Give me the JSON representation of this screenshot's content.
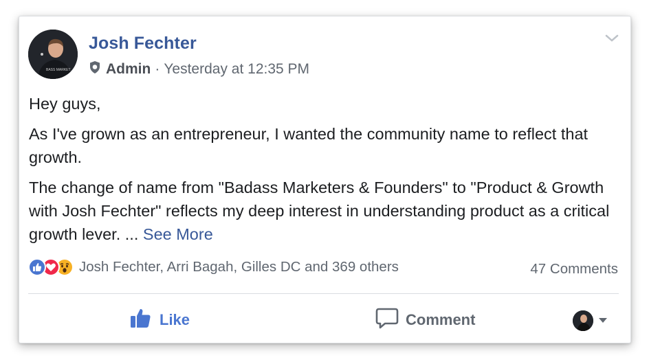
{
  "post": {
    "author": "Josh Fechter",
    "role": "Admin",
    "separator": "·",
    "timestamp": "Yesterday at 12:35 PM",
    "paragraphs": [
      "Hey guys,",
      "As I've grown as an entrepreneur, I wanted the community name to reflect that growth.",
      "The change of name from \"Badass Marketers & Founders\" to \"Product & Growth with Josh Fechter\" reflects my deep interest in understanding product as a critical growth lever. ..."
    ],
    "see_more": "See More"
  },
  "reactions": {
    "types": [
      "like-icon",
      "love-icon",
      "wow-icon"
    ],
    "names": "Josh Fechter, Arri Bagah, Gilles DC and 369 others",
    "comments": "47 Comments"
  },
  "actions": {
    "like": "Like",
    "comment": "Comment"
  },
  "colors": {
    "link": "#385898",
    "like_blue": "#4a76d0",
    "love_red": "#f0284a",
    "wow_yellow": "#f7b125",
    "meta_gray": "#606770"
  }
}
